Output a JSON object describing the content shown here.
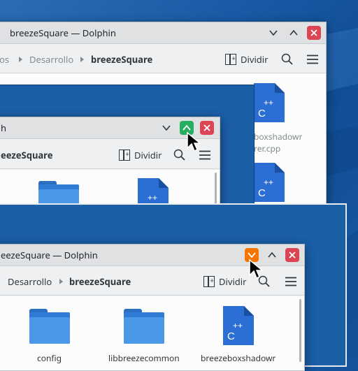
{
  "windows": {
    "back": {
      "title": "breezeSquare — Dolphin",
      "breadcrumb": [
        "os",
        "Desarrollo",
        "breezeSquare"
      ],
      "split_label": "Dividir",
      "file_labels": [
        "boxshadowr",
        "rer.cpp"
      ]
    },
    "middle": {
      "title": "h",
      "breadcrumb": [
        "eezeSquare"
      ],
      "split_label": "Dividir"
    },
    "front": {
      "title": "eezeSquare — Dolphin",
      "breadcrumb": [
        "Desarrollo",
        "breezeSquare"
      ],
      "split_label": "Dividir",
      "items": [
        {
          "label": "config",
          "type": "folder"
        },
        {
          "label": "libbreezecommon",
          "type": "folder"
        },
        {
          "label": "breezeboxshadowr",
          "type": "cpp-file"
        }
      ]
    }
  },
  "colors": {
    "close": "#da4453",
    "maximize_hover": "#27ae60",
    "minimize_hover": "#f67400",
    "accent": "#3daee9"
  }
}
